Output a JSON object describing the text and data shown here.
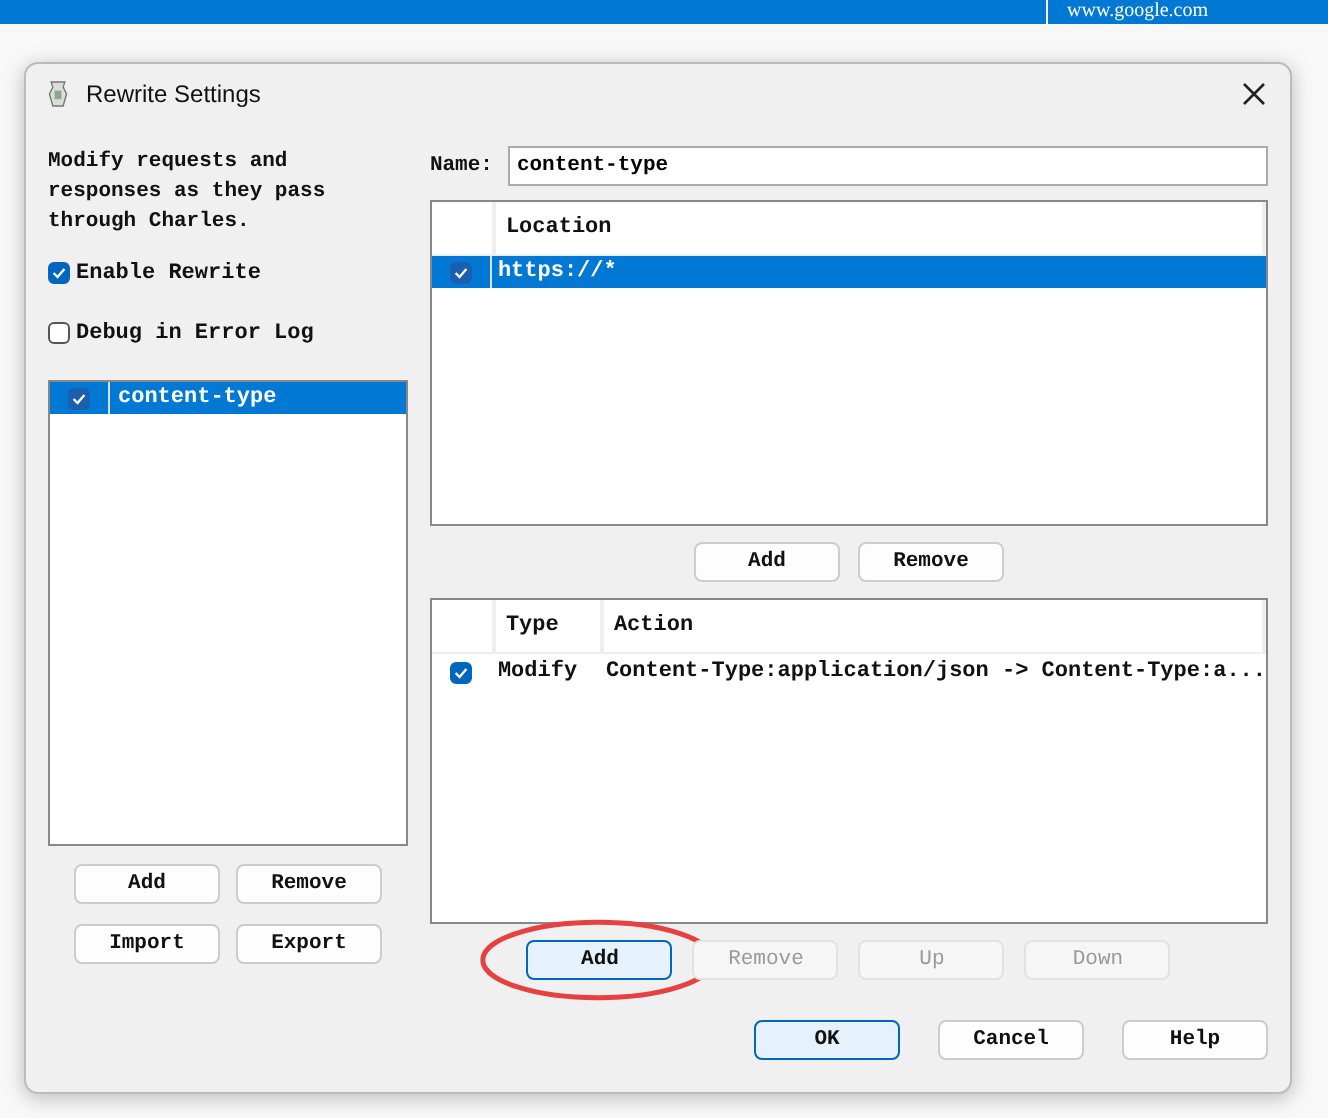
{
  "top_bar": {
    "text": "www.google.com"
  },
  "window": {
    "title": "Rewrite Settings"
  },
  "description": "Modify requests and responses as they pass through Charles.",
  "options": [
    {
      "label": "Enable Rewrite",
      "checked": true
    },
    {
      "label": "Debug in Error Log",
      "checked": false
    }
  ],
  "sets": [
    {
      "name": "content-type",
      "checked": true,
      "selected": true
    }
  ],
  "set_buttons": [
    {
      "label": "Add",
      "disabled": false
    },
    {
      "label": "Remove",
      "disabled": false
    },
    {
      "label": "Import",
      "disabled": false
    },
    {
      "label": "Export",
      "disabled": false
    }
  ],
  "name_field": {
    "label": "Name:",
    "value": "content-type"
  },
  "locations": {
    "columns": [
      "Location"
    ],
    "rows": [
      {
        "location": "https://*",
        "checked": true,
        "selected": true
      }
    ]
  },
  "location_buttons": [
    {
      "label": "Add",
      "disabled": false
    },
    {
      "label": "Remove",
      "disabled": false
    }
  ],
  "rules": {
    "columns": [
      "Type",
      "Action"
    ],
    "rows": [
      {
        "type": "Modify",
        "action": "Content-Type:application/json -> Content-Type:a...",
        "checked": true,
        "selected": false
      }
    ]
  },
  "rule_buttons": [
    {
      "label": "Add",
      "disabled": false,
      "focused": true,
      "circled": true
    },
    {
      "label": "Remove",
      "disabled": true,
      "focused": false,
      "circled": false
    },
    {
      "label": "Up",
      "disabled": true,
      "focused": false,
      "circled": false
    },
    {
      "label": "Down",
      "disabled": true,
      "focused": false,
      "circled": false
    }
  ],
  "dialog_buttons": [
    {
      "label": "OK",
      "default": true
    },
    {
      "label": "Cancel",
      "default": false
    },
    {
      "label": "Help",
      "default": false
    }
  ]
}
